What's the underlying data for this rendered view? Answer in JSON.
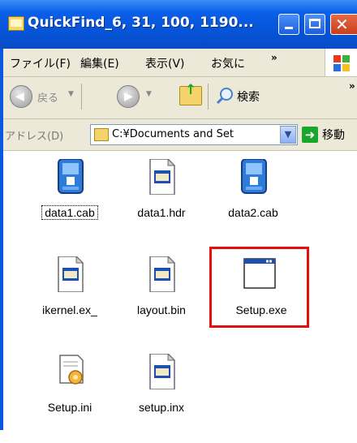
{
  "window": {
    "title": "QuickFind_6, 31, 100, 1190..."
  },
  "menubar": {
    "items": [
      "ファイル(F)",
      "編集(E)",
      "表示(V)",
      "お気に"
    ],
    "more": "»"
  },
  "toolbar": {
    "back_label": "戻る",
    "search_label": "検索",
    "more": "»"
  },
  "address": {
    "label": "アドレス(D)",
    "value": "C:¥Documents and Set",
    "go_label": "移動"
  },
  "files": [
    {
      "name": "data1.cab",
      "icon": "cab-icon"
    },
    {
      "name": "data1.hdr",
      "icon": "document-icon"
    },
    {
      "name": "data2.cab",
      "icon": "cab-icon"
    },
    {
      "name": "ikernel.ex_",
      "icon": "document-icon"
    },
    {
      "name": "layout.bin",
      "icon": "document-icon"
    },
    {
      "name": "Setup.exe",
      "icon": "application-icon"
    },
    {
      "name": "Setup.ini",
      "icon": "settings-file-icon"
    },
    {
      "name": "setup.inx",
      "icon": "document-icon"
    }
  ],
  "colors": {
    "titlebar": "#0552d6",
    "highlight": "#e60d0d",
    "window_bg": "#ece9d8"
  }
}
